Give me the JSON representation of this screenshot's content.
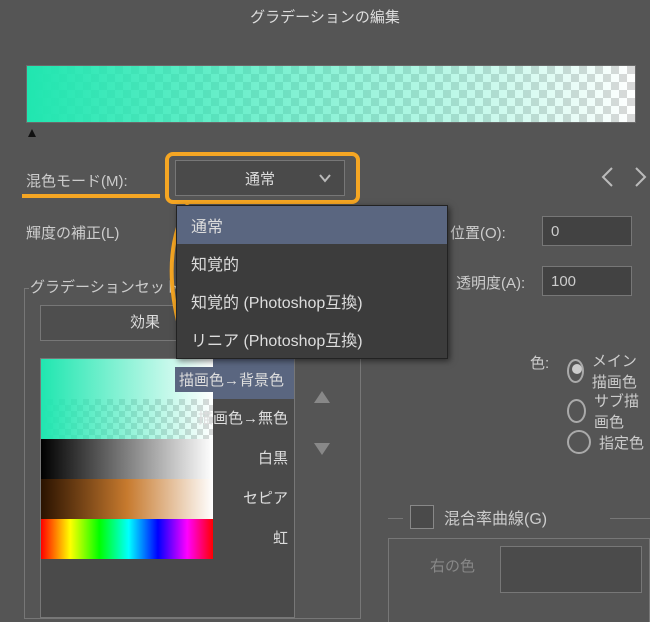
{
  "window_title": "グラデーションの編集",
  "blend_mode": {
    "label": "混色モード(M):",
    "value": "通常",
    "options": [
      "通常",
      "知覚的",
      "知覚的 (Photoshop互換)",
      "リニア (Photoshop互換)"
    ]
  },
  "brightness_label": "輝度の補正(L)",
  "gradset_label": "グラデーションセット",
  "effect_button": "効果",
  "position": {
    "label": "位置(O):",
    "value": "0"
  },
  "opacity": {
    "label": "透明度(A):",
    "value": "100"
  },
  "color_section": {
    "label": "色:",
    "main": "メイン描画色",
    "sub": "サブ描画色",
    "spec": "指定色"
  },
  "blend_curve_label": "混合率曲線(G)",
  "right_color_label": "右の色",
  "presets": [
    {
      "name": "描画色→背景色"
    },
    {
      "name": "描画色→無色"
    },
    {
      "name": "白黒"
    },
    {
      "name": "セピア"
    },
    {
      "name": "虹"
    }
  ]
}
